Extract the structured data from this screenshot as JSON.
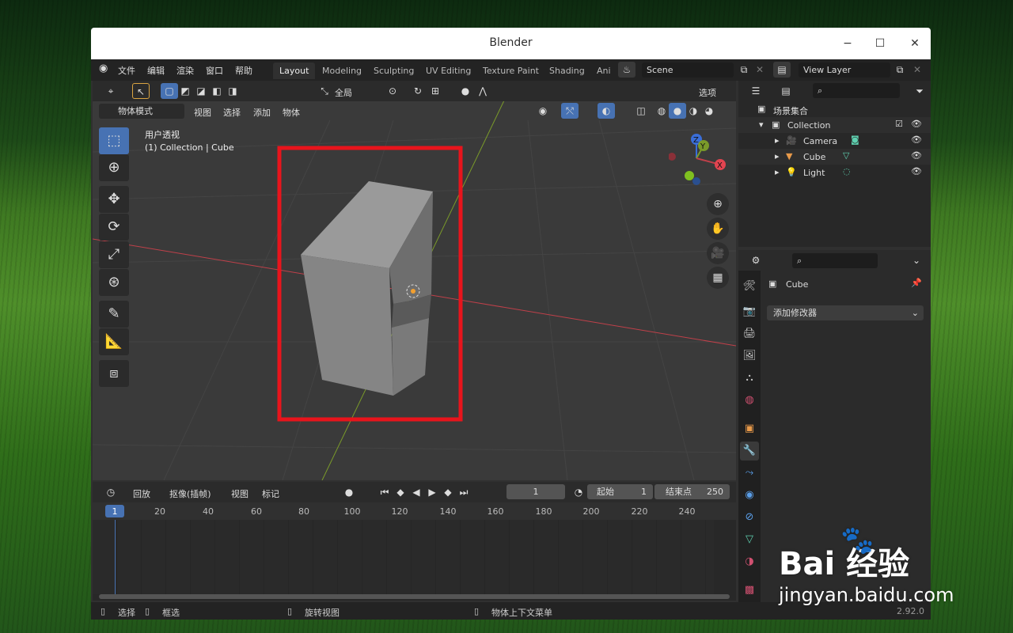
{
  "window": {
    "title": "Blender",
    "minimize": "−",
    "maximize": "☐",
    "close": "✕"
  },
  "menubar": {
    "items": [
      "文件",
      "编辑",
      "渲染",
      "窗口",
      "帮助"
    ],
    "workspaces": [
      "Layout",
      "Modeling",
      "Sculpting",
      "UV Editing",
      "Texture Paint",
      "Shading",
      "Ani"
    ],
    "active_workspace": "Layout",
    "scene": "Scene",
    "view_layer": "View Layer"
  },
  "viewport": {
    "transform_orientation": "全局",
    "options_label": "选项",
    "mode": "物体模式",
    "menus": [
      "视图",
      "选择",
      "添加",
      "物体"
    ],
    "view_name": "用户透视",
    "collection_info": "(1) Collection | Cube"
  },
  "gizmo": {
    "z": "Z",
    "y": "Y",
    "x": "X"
  },
  "timeline": {
    "playback": "回放",
    "keying": "抠像(插帧)",
    "menus": [
      "视图",
      "标记"
    ],
    "current_frame": "1",
    "start_label": "起始",
    "start": "1",
    "end_label": "结束点",
    "end": "250",
    "ruler": [
      "1",
      "20",
      "40",
      "60",
      "80",
      "100",
      "120",
      "140",
      "160",
      "180",
      "200",
      "220",
      "240"
    ]
  },
  "outliner": {
    "root": "场景集合",
    "items": [
      {
        "label": "Collection",
        "icon": "collection-icon"
      },
      {
        "label": "Camera",
        "icon": "camera-icon"
      },
      {
        "label": "Cube",
        "icon": "mesh-icon"
      },
      {
        "label": "Light",
        "icon": "light-icon"
      }
    ]
  },
  "properties": {
    "object_name": "Cube",
    "add_modifier": "添加修改器"
  },
  "statusbar": {
    "select": "选择",
    "box_select": "框选",
    "rotate_view": "旋转视图",
    "context_menu": "物体上下文菜单",
    "version": "2.92.0"
  },
  "watermark": {
    "brand": "Bai  经验",
    "url": "jingyan.baidu.com"
  },
  "colors": {
    "accent": "#4772b3",
    "highlight_box": "#e8141c",
    "x_axis": "#c0404a",
    "y_axis": "#7a9a2a"
  }
}
